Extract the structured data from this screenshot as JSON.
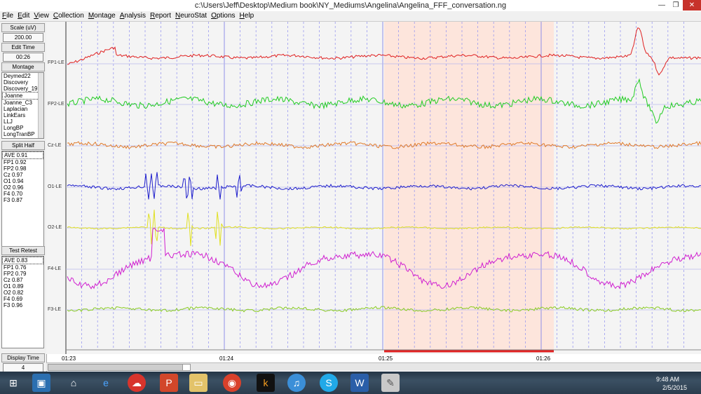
{
  "window": {
    "title": "c:\\Users\\Jeff\\Desktop\\Medium book\\NY_Mediums\\Angelina\\Angelina_FFF_conversation.ng",
    "min_glyph": "—",
    "max_glyph": "❐",
    "close_glyph": "✕"
  },
  "menu": [
    "File",
    "Edit",
    "View",
    "Collection",
    "Montage",
    "Analysis",
    "Report",
    "NeuroStat",
    "Options",
    "Help"
  ],
  "left_panel": {
    "scale_label": "Scale (uV)",
    "scale_value": "200.00",
    "edit_time_label": "Edit Time",
    "edit_time_value": "00:26",
    "montage_label": "Montage",
    "montages": [
      "Deymed22",
      "Discovery",
      "Discovery_19",
      "Joanne",
      "Joanne_C3",
      "Laplacian",
      "LinkEars",
      "LLJ",
      "LongBP",
      "LongTranBP"
    ],
    "montage_selected": "Joanne",
    "split_half_label": "Split Half",
    "split_half": [
      "AVE  0.91",
      "FP1  0.92",
      "FP2  0.98",
      "Cz  0.97",
      "O1  0.94",
      "O2  0.96",
      "F4  0.70",
      "F3  0.87"
    ],
    "test_retest_label": "Test Retest",
    "test_retest": [
      "AVE  0.83",
      "FP1  0.76",
      "FP2  0.79",
      "Cz  0.87",
      "O1  0.89",
      "O2  0.82",
      "F4  0.69",
      "F3  0.96"
    ],
    "display_time_label": "Display Time",
    "display_time_value": "4"
  },
  "channels": [
    {
      "name": "FP1-LE",
      "color": "#e02020"
    },
    {
      "name": "FP2-LE",
      "color": "#22cc22"
    },
    {
      "name": "Cz-LE",
      "color": "#e07a2a"
    },
    {
      "name": "O1-LE",
      "color": "#1f1fcc"
    },
    {
      "name": "O2-LE",
      "color": "#e0e020"
    },
    {
      "name": "F4-LE",
      "color": "#d020d0"
    },
    {
      "name": "F3-LE",
      "color": "#8acc22"
    }
  ],
  "time_labels": [
    "01:23",
    "01:24",
    "01:25",
    "01:26"
  ],
  "taskbar": {
    "clock_time": "9:48 AM",
    "clock_date": "2/5/2015",
    "apps": [
      "windows-start",
      "file-explorer-app",
      "home",
      "internet-explorer",
      "cloud-app",
      "powerpoint",
      "folder",
      "chrome",
      "kindle",
      "itunes",
      "skype",
      "word",
      "neuroguide"
    ]
  },
  "colors": {
    "selection": "#fde5dc",
    "guide_solid": "#8f8fe8",
    "guide_dotted": "#9a9af0"
  }
}
